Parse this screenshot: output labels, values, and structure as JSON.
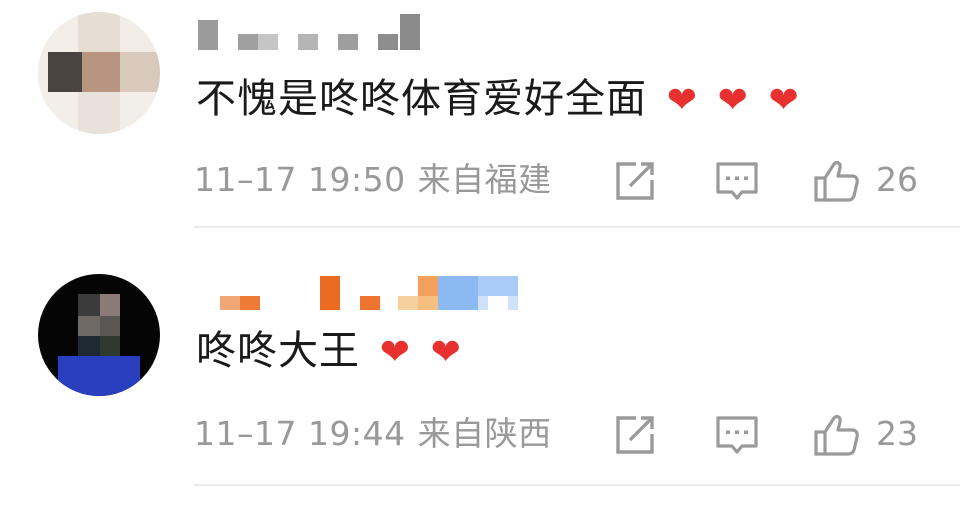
{
  "comments": [
    {
      "text": "不愧是咚咚体育爱好全面",
      "hearts": [
        "❤",
        "❤",
        "❤"
      ],
      "time": "11–17 19:50",
      "location": "来自福建",
      "like_count": "26",
      "icons": [
        "share-icon",
        "reply-icon",
        "thumbs-up-icon"
      ]
    },
    {
      "text": "咚咚大王",
      "hearts": [
        "❤",
        "❤"
      ],
      "time": "11–17 19:44",
      "location": "来自陕西",
      "like_count": "23",
      "icons": [
        "share-icon",
        "reply-icon",
        "thumbs-up-icon"
      ]
    }
  ],
  "colors": {
    "heart": "#e8302e",
    "meta_text": "#999999",
    "icon_stroke": "#9a9a9a",
    "divider": "#ececec"
  }
}
